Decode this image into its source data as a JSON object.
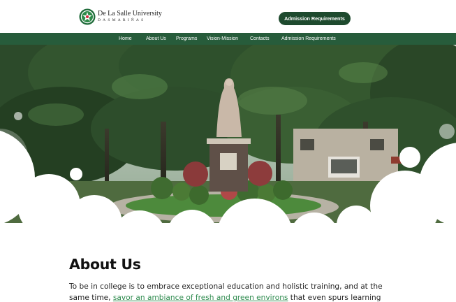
{
  "header": {
    "logo_name": "De La Salle University",
    "logo_subtitle": "DASMARIÑAS",
    "cta_label": "Admission Requirements"
  },
  "nav": {
    "items": [
      {
        "label": "Home"
      },
      {
        "label": "About Us"
      },
      {
        "label": "Programs"
      },
      {
        "label": "Vision-Mission"
      },
      {
        "label": "Contacts"
      },
      {
        "label": "Admission Requirements"
      }
    ]
  },
  "hero": {
    "image": "campus-statue-photo"
  },
  "about": {
    "heading": "About Us",
    "text_part1": "To be in college is to embrace exceptional education and holistic training, and at the same time, ",
    "link_text": "savor an ambiance of fresh and green environs",
    "text_part2": " that even spurs learning"
  },
  "colors": {
    "brand_green": "#275c3b",
    "cta_green": "#1e4a2e",
    "link_green": "#2e8b4e"
  }
}
